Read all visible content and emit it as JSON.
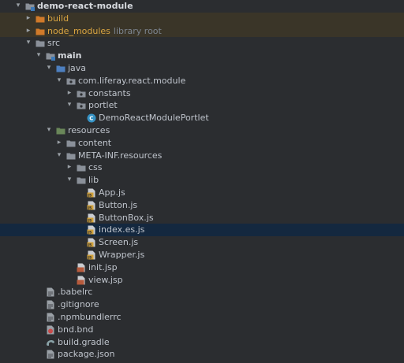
{
  "tree": [
    {
      "label": "demo-react-module",
      "depth": 0,
      "arrow": "open",
      "icon": "module-folder-icon",
      "bold": true
    },
    {
      "label": "build",
      "depth": 1,
      "arrow": "closed",
      "icon": "excluded-folder-icon",
      "excluded": true
    },
    {
      "label": "node_modules",
      "suffix": "library root",
      "depth": 1,
      "arrow": "closed",
      "icon": "excluded-folder-icon",
      "excluded": true
    },
    {
      "label": "src",
      "depth": 1,
      "arrow": "open",
      "icon": "folder-icon"
    },
    {
      "label": "main",
      "depth": 2,
      "arrow": "open",
      "icon": "module-folder-icon",
      "bold": true
    },
    {
      "label": "java",
      "depth": 3,
      "arrow": "open",
      "icon": "source-folder-icon"
    },
    {
      "label": "com.liferay.react.module",
      "depth": 4,
      "arrow": "open",
      "icon": "package-icon"
    },
    {
      "label": "constants",
      "depth": 5,
      "arrow": "closed",
      "icon": "package-icon"
    },
    {
      "label": "portlet",
      "depth": 5,
      "arrow": "open",
      "icon": "package-icon"
    },
    {
      "label": "DemoReactModulePortlet",
      "depth": 6,
      "arrow": "none",
      "icon": "class-icon"
    },
    {
      "label": "resources",
      "depth": 3,
      "arrow": "open",
      "icon": "resources-folder-icon"
    },
    {
      "label": "content",
      "depth": 4,
      "arrow": "closed",
      "icon": "folder-icon"
    },
    {
      "label": "META-INF.resources",
      "depth": 4,
      "arrow": "open",
      "icon": "folder-icon"
    },
    {
      "label": "css",
      "depth": 5,
      "arrow": "closed",
      "icon": "folder-icon"
    },
    {
      "label": "lib",
      "depth": 5,
      "arrow": "open",
      "icon": "folder-icon"
    },
    {
      "label": "App.js",
      "depth": 6,
      "arrow": "none",
      "icon": "js-file-icon"
    },
    {
      "label": "Button.js",
      "depth": 6,
      "arrow": "none",
      "icon": "js-file-icon"
    },
    {
      "label": "ButtonBox.js",
      "depth": 6,
      "arrow": "none",
      "icon": "js-file-icon"
    },
    {
      "label": "index.es.js",
      "depth": 6,
      "arrow": "none",
      "icon": "js-file-icon",
      "selected": true
    },
    {
      "label": "Screen.js",
      "depth": 6,
      "arrow": "none",
      "icon": "js-file-icon"
    },
    {
      "label": "Wrapper.js",
      "depth": 6,
      "arrow": "none",
      "icon": "js-file-icon"
    },
    {
      "label": "init.jsp",
      "depth": 5,
      "arrow": "none",
      "icon": "jsp-file-icon"
    },
    {
      "label": "view.jsp",
      "depth": 5,
      "arrow": "none",
      "icon": "jsp-file-icon"
    },
    {
      "label": ".babelrc",
      "depth": 2,
      "arrow": "none",
      "icon": "text-file-icon"
    },
    {
      "label": ".gitignore",
      "depth": 2,
      "arrow": "none",
      "icon": "text-file-icon"
    },
    {
      "label": ".npmbundlerrc",
      "depth": 2,
      "arrow": "none",
      "icon": "text-file-icon"
    },
    {
      "label": "bnd.bnd",
      "depth": 2,
      "arrow": "none",
      "icon": "bnd-file-icon"
    },
    {
      "label": "build.gradle",
      "depth": 2,
      "arrow": "none",
      "icon": "gradle-file-icon"
    },
    {
      "label": "package.json",
      "depth": 2,
      "arrow": "none",
      "icon": "text-file-icon"
    }
  ],
  "colors": {
    "background": "#2b2d30",
    "selected_row": "#14283f",
    "excluded_row": "#3a3528",
    "excluded_text": "#d9a441",
    "folder": "#8a9099",
    "excluded_folder": "#d07a2a",
    "source_folder": "#4d7fbf",
    "resources_folder": "#6a8759",
    "js_icon": "#d1a13a",
    "class_icon": "#3592c4"
  }
}
